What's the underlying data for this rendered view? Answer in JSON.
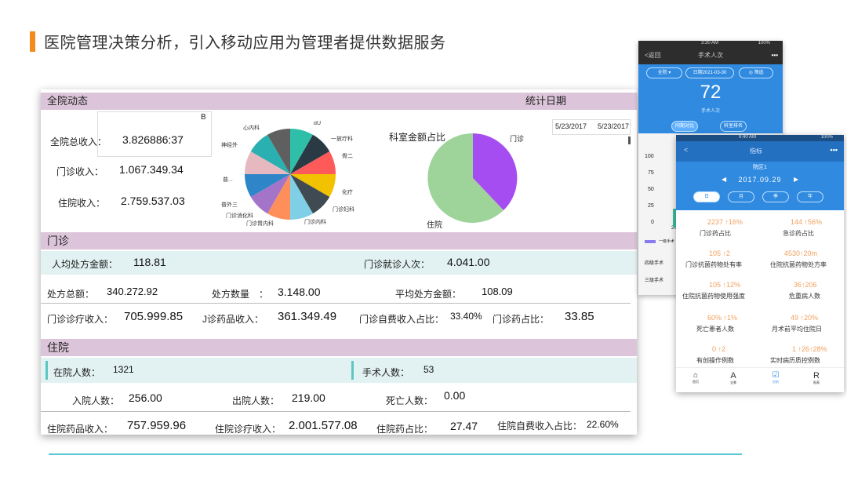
{
  "page": {
    "title": "医院管理决策分析，引入移动应用为管理者提供数据服务"
  },
  "dashboard": {
    "header": {
      "title": "全院动态",
      "date_label": "统计日期",
      "date_start": "5/23/2017",
      "date_end": "5/23/2017",
      "corner": "B"
    },
    "summary": {
      "total_label": "全院总收入：",
      "total_value": "3.826886:37",
      "outpatient_label": "门诊收入：",
      "outpatient_value": "1.067.349.34",
      "inpatient_label": "住院收入：",
      "inpatient_value": "2.759.537.03"
    },
    "pie1_labels": [
      "心内科",
      "αU",
      "一放疗科",
      "骨二",
      "化疗",
      "门诊妇科",
      "门诊内科",
      "门诊胃内科",
      "门诊消化科",
      "普外三",
      "普...",
      "神经外"
    ],
    "pie2": {
      "title": "科室金额占比",
      "label_a": "门诊",
      "label_b": "住院"
    },
    "outpatient": {
      "section": "门诊",
      "avg_rx_label": "人均处方金额：",
      "avg_rx_value": "118.81",
      "visits_label": "门诊就诊人次：",
      "visits_value": "4.041.00",
      "rx_total_label": "处方总额：",
      "rx_total_value": "340.272.92",
      "rx_count_label": "处方数量　：",
      "rx_count_value": "3.148.00",
      "rx_avg_label": "平均处方金额：",
      "rx_avg_value": "108.09",
      "treat_label": "门诊诊疗收入：",
      "treat_value": "705.999.85",
      "drug_label": "J诊药品收入：",
      "drug_value": "361.349.49",
      "self_label": "门诊自费收入占比：",
      "self_value": "33.40%",
      "drug_ratio_label": "门诊药占比：",
      "drug_ratio_value": "33.85"
    },
    "inpatient": {
      "section": "住院",
      "in_label": "在院人数：",
      "in_value": "1321",
      "surgery_label": "手术人数：",
      "surgery_value": "53",
      "admit_label": "入院人数：",
      "admit_value": "256.00",
      "discharge_label": "出院人数：",
      "discharge_value": "219.00",
      "death_label": "死亡人数：",
      "death_value": "0.00",
      "drug_label": "住院药品收入：",
      "drug_value": "757.959.96",
      "treat_label": "住院诊疗收入：",
      "treat_value": "2.001.577.08",
      "ratio_label": "住院药占比：",
      "ratio_value": "27.47",
      "self_label": "住院自费收入占比：",
      "self_value": "22.60%"
    }
  },
  "phone1": {
    "status_time": "3:30 AM",
    "status_batt": "100%",
    "back": "<返回",
    "title": "手术人次",
    "menu": "•••",
    "chip1": "全院 ▾",
    "chip2": "日期2021-03-30",
    "chip3": "◎ 筛选",
    "value": "72",
    "value_label": "手术人次",
    "btn1": "同期对比",
    "btn2": "科室排名",
    "yticks": [
      "100",
      "75",
      "50",
      "25",
      "0"
    ],
    "x_tick": "20",
    "legend": [
      "一级手术",
      "四级手术",
      "三级手术"
    ]
  },
  "phone2": {
    "status_time": "9:40 AM",
    "status_batt": "100%",
    "back": "<",
    "title": "指标",
    "menu": "•••",
    "sub": "院区1",
    "date": "2017.09.29",
    "tabs": [
      "日",
      "月",
      "季",
      "年"
    ],
    "stats": [
      {
        "num": "2237 ↑16%",
        "label": "门诊药占比"
      },
      {
        "num": "144 ↑56%",
        "label": "急诊药占比"
      },
      {
        "num": "105 ↑2",
        "label": "门诊抗菌药物处有率"
      },
      {
        "num": "4530↑20m",
        "label": "住院抗菌药物处方率"
      },
      {
        "num": "105 ↑12%",
        "label": "住院抗菌药物使用强度"
      },
      {
        "num": "36↑206",
        "label": "危重病人数"
      },
      {
        "num": "60% ↑1%",
        "label": "死亡患者人数"
      },
      {
        "num": "49 ↑20%",
        "label": "月术前平均住院日"
      },
      {
        "num": "0 ↑2",
        "label": "有创操作例数"
      },
      {
        "num": "1 ↑26↑28%",
        "label": "实时病历质控例数"
      }
    ],
    "nav": [
      {
        "icon": "⌂",
        "label": "首页"
      },
      {
        "icon": "A",
        "label": "全景"
      },
      {
        "icon": "☑",
        "label": "分析"
      },
      {
        "icon": "R",
        "label": "报表"
      }
    ]
  },
  "colors": {
    "accent": "#f28a1e",
    "header": "#dcc5da",
    "teal_row": "#e2f1f1",
    "phone_blue": "#2f8ae0",
    "pie2_purple": "#a54df0",
    "pie2_green": "#9ed39a"
  }
}
